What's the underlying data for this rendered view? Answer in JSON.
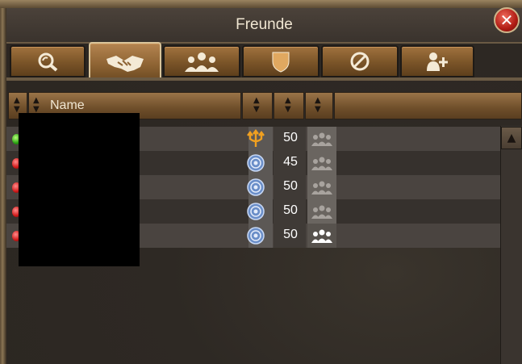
{
  "window": {
    "title": "Freunde",
    "close_label": "✕"
  },
  "tabs": [
    {
      "name": "search",
      "icon": "search-icon"
    },
    {
      "name": "friends",
      "icon": "handshake-icon",
      "active": true
    },
    {
      "name": "group",
      "icon": "group-icon"
    },
    {
      "name": "guild",
      "icon": "shield-icon"
    },
    {
      "name": "ignore",
      "icon": "block-icon"
    },
    {
      "name": "add-friend",
      "icon": "add-person-icon"
    }
  ],
  "header": {
    "name_label": "Name"
  },
  "friends": [
    {
      "online": true,
      "emblem": "trident-emblem-icon",
      "level": "50",
      "in_group": false
    },
    {
      "online": false,
      "emblem": "blue-emblem-icon",
      "level": "45",
      "in_group": false
    },
    {
      "online": false,
      "emblem": "blue-emblem-icon",
      "level": "50",
      "in_group": false
    },
    {
      "online": false,
      "emblem": "blue-emblem-icon",
      "level": "50",
      "in_group": false
    },
    {
      "online": false,
      "emblem": "blue-emblem-icon",
      "level": "50",
      "in_group": true
    }
  ],
  "colors": {
    "online": "#2ea414",
    "offline": "#d21c1c",
    "tab": "#8c6232",
    "title": "#f0e6d2"
  }
}
